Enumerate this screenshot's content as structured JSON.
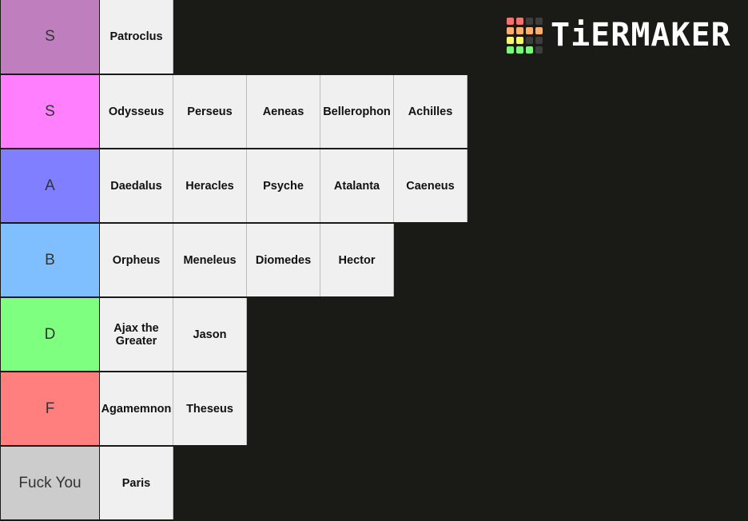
{
  "logo": {
    "text": "TiERMAKER",
    "grid_colors": [
      "#f27171",
      "#f27171",
      "#3d3d3d",
      "#3d3d3d",
      "#f9b06f",
      "#f9b06f",
      "#f9b06f",
      "#f9b06f",
      "#f7f76e",
      "#f7f76e",
      "#3d3d3d",
      "#3d3d3d",
      "#7cf77c",
      "#7cf77c",
      "#7cf77c",
      "#3d3d3d"
    ]
  },
  "tiers": [
    {
      "label": "S",
      "color": "#bf7fbf",
      "items": [
        "Patroclus"
      ]
    },
    {
      "label": "S",
      "color": "#ff7fff",
      "items": [
        "Odysseus",
        "Perseus",
        "Aeneas",
        "Bellerophon",
        "Achilles"
      ]
    },
    {
      "label": "A",
      "color": "#7f7fff",
      "items": [
        "Daedalus",
        "Heracles",
        "Psyche",
        "Atalanta",
        "Caeneus"
      ]
    },
    {
      "label": "B",
      "color": "#7fbfff",
      "items": [
        "Orpheus",
        "Meneleus",
        "Diomedes",
        "Hector"
      ]
    },
    {
      "label": "D",
      "color": "#7fff7f",
      "items": [
        "Ajax the Greater",
        "Jason"
      ]
    },
    {
      "label": "F",
      "color": "#ff7f7f",
      "items": [
        "Agamemnon",
        "Theseus"
      ]
    },
    {
      "label": "Fuck You",
      "color": "#cccccc",
      "items": [
        "Paris"
      ]
    }
  ]
}
